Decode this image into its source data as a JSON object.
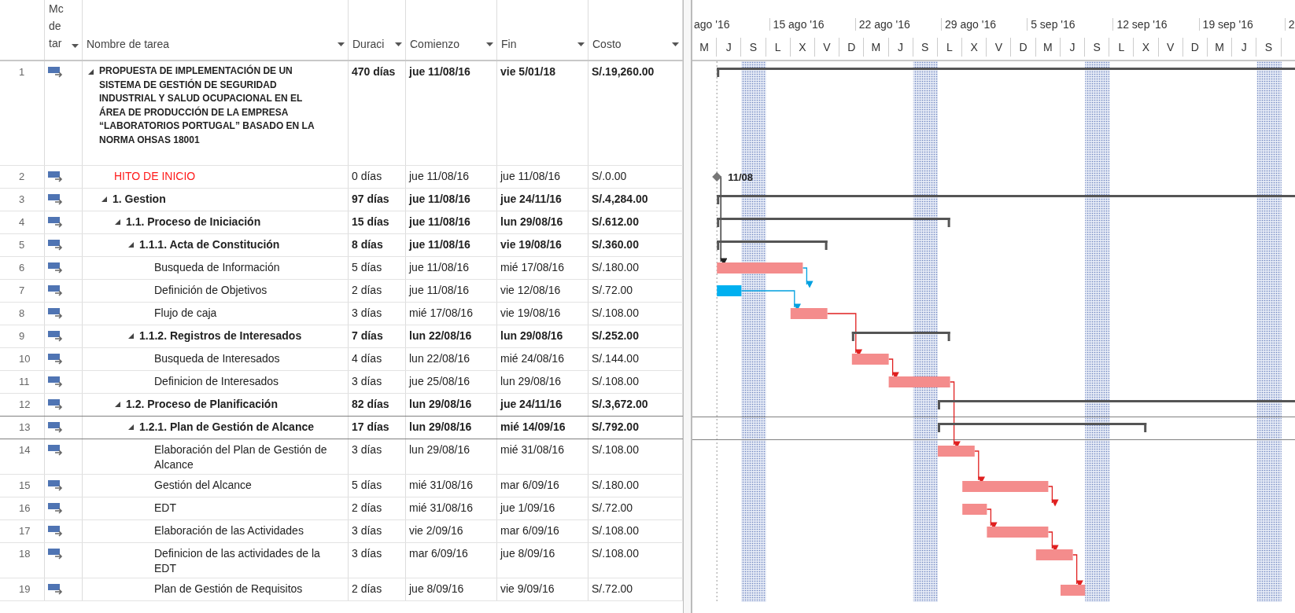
{
  "columns": [
    {
      "label": "Mc de tar"
    },
    {
      "label": "Nombre de tarea"
    },
    {
      "label": "Duraci"
    },
    {
      "label": "Comienzo"
    },
    {
      "label": "Fin"
    },
    {
      "label": "Costo"
    }
  ],
  "timescale": {
    "weeks": [
      "ago '16",
      "15 ago '16",
      "22 ago '16",
      "29 ago '16",
      "5 sep '16",
      "12 sep '16",
      "19 sep '16",
      "2"
    ],
    "days": [
      "M",
      "J",
      "S",
      "L",
      "X",
      "V",
      "D",
      "M",
      "J",
      "S",
      "L",
      "X",
      "V",
      "D",
      "M",
      "J",
      "S",
      "L",
      "X",
      "V",
      "D",
      "M",
      "J",
      "S"
    ]
  },
  "rows": [
    {
      "id": "1",
      "kind": "summary",
      "expanded": true,
      "selected": false,
      "name": "PROPUESTA DE IMPLEMENTACIÓN DE UN SISTEMA DE GESTIÓN DE SEGURIDAD INDUSTRIAL Y SALUD OCUPACIONAL EN EL ÁREA DE PRODUCCIÓN DE LA EMPRESA “LABORATORIOS PORTUGAL” BASADO EN LA NORMA OHSAS 18001",
      "duration": "470 días",
      "start": "jue 11/08/16",
      "finish": "vie 5/01/18",
      "cost": "S/.19,260.00",
      "children": [
        {
          "id": "2",
          "kind": "milestone",
          "selected": false,
          "name": "HITO DE INICIO",
          "duration": "0 días",
          "start": "jue 11/08/16",
          "finish": "jue 11/08/16",
          "cost": "S/.0.00",
          "label": "11/08"
        },
        {
          "id": "3",
          "kind": "summary",
          "expanded": true,
          "selected": false,
          "name": "1. Gestion",
          "duration": "97 días",
          "start": "jue 11/08/16",
          "finish": "jue 24/11/16",
          "cost": "S/.4,284.00",
          "children": [
            {
              "id": "4",
              "kind": "summary",
              "expanded": true,
              "selected": false,
              "name": "1.1. Proceso de Iniciación",
              "duration": "15 días",
              "start": "jue 11/08/16",
              "finish": "lun 29/08/16",
              "cost": "S/.612.00",
              "children": [
                {
                  "id": "5",
                  "kind": "summary",
                  "expanded": true,
                  "selected": false,
                  "name": "1.1.1. Acta de Constitución",
                  "duration": "8 días",
                  "start": "jue 11/08/16",
                  "finish": "vie 19/08/16",
                  "cost": "S/.360.00",
                  "children": [
                    {
                      "id": "6",
                      "kind": "task",
                      "critical": true,
                      "selected": false,
                      "name": "Busqueda de Información",
                      "duration": "5 días",
                      "start": "jue 11/08/16",
                      "finish": "mié 17/08/16",
                      "cost": "S/.180.00"
                    },
                    {
                      "id": "7",
                      "kind": "task",
                      "critical": false,
                      "selected": false,
                      "name": "Definición de Objetivos",
                      "duration": "2 días",
                      "start": "jue 11/08/16",
                      "finish": "vie 12/08/16",
                      "cost": "S/.72.00"
                    },
                    {
                      "id": "8",
                      "kind": "task",
                      "critical": true,
                      "selected": false,
                      "name": "Flujo de caja",
                      "duration": "3 días",
                      "start": "mié 17/08/16",
                      "finish": "vie 19/08/16",
                      "cost": "S/.108.00"
                    }
                  ]
                },
                {
                  "id": "9",
                  "kind": "summary",
                  "expanded": true,
                  "selected": false,
                  "name": "1.1.2. Registros de Interesados",
                  "duration": "7 días",
                  "start": "lun 22/08/16",
                  "finish": "lun 29/08/16",
                  "cost": "S/.252.00",
                  "children": [
                    {
                      "id": "10",
                      "kind": "task",
                      "critical": true,
                      "selected": false,
                      "name": "Busqueda de Interesados",
                      "duration": "4 días",
                      "start": "lun 22/08/16",
                      "finish": "mié 24/08/16",
                      "cost": "S/.144.00"
                    },
                    {
                      "id": "11",
                      "kind": "task",
                      "critical": true,
                      "selected": false,
                      "name": "Definicion de Interesados",
                      "duration": "3 días",
                      "start": "jue 25/08/16",
                      "finish": "lun 29/08/16",
                      "cost": "S/.108.00"
                    }
                  ]
                }
              ]
            },
            {
              "id": "12",
              "kind": "summary",
              "expanded": true,
              "selected": false,
              "name": "1.2. Proceso de Planificación",
              "duration": "82 días",
              "start": "lun 29/08/16",
              "finish": "jue 24/11/16",
              "cost": "S/.3,672.00",
              "children": [
                {
                  "id": "13",
                  "kind": "summary",
                  "expanded": true,
                  "selected": true,
                  "name": "1.2.1. Plan de Gestión de Alcance",
                  "duration": "17 días",
                  "start": "lun 29/08/16",
                  "finish": "mié 14/09/16",
                  "cost": "S/.792.00",
                  "children": [
                    {
                      "id": "14",
                      "kind": "task",
                      "critical": true,
                      "selected": false,
                      "name": "Elaboración del Plan de Gestión de Alcance",
                      "duration": "3 días",
                      "start": "lun 29/08/16",
                      "finish": "mié 31/08/16",
                      "cost": "S/.108.00"
                    },
                    {
                      "id": "15",
                      "kind": "task",
                      "critical": true,
                      "selected": false,
                      "name": "Gestión del Alcance",
                      "duration": "5 días",
                      "start": "mié 31/08/16",
                      "finish": "mar 6/09/16",
                      "cost": "S/.180.00"
                    },
                    {
                      "id": "16",
                      "kind": "task",
                      "critical": true,
                      "selected": false,
                      "name": "EDT",
                      "duration": "2 días",
                      "start": "mié 31/08/16",
                      "finish": "jue 1/09/16",
                      "cost": "S/.72.00"
                    },
                    {
                      "id": "17",
                      "kind": "task",
                      "critical": true,
                      "selected": false,
                      "name": "Elaboración de las Actividades",
                      "duration": "3 días",
                      "start": "vie 2/09/16",
                      "finish": "mar 6/09/16",
                      "cost": "S/.108.00"
                    },
                    {
                      "id": "18",
                      "kind": "task",
                      "critical": true,
                      "selected": false,
                      "name": "Definicion de las actividades de la EDT",
                      "duration": "3 días",
                      "start": "mar 6/09/16",
                      "finish": "jue 8/09/16",
                      "cost": "S/.108.00"
                    },
                    {
                      "id": "19",
                      "kind": "task",
                      "critical": true,
                      "selected": false,
                      "name": "Plan de Gestión de Requisitos",
                      "duration": "2 días",
                      "start": "jue 8/09/16",
                      "finish": "vie 9/09/16",
                      "cost": "S/.72.00"
                    }
                  ]
                }
              ]
            }
          ]
        }
      ]
    }
  ]
}
